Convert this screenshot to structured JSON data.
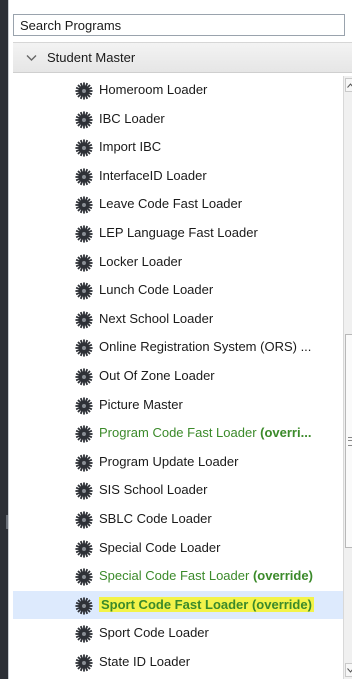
{
  "search": {
    "placeholder": "Search Programs",
    "value": ""
  },
  "group": {
    "title": "Student Master",
    "expanded": true
  },
  "items": [
    {
      "label": "Homeroom Loader",
      "suffix": ""
    },
    {
      "label": "IBC Loader",
      "suffix": ""
    },
    {
      "label": "Import IBC",
      "suffix": ""
    },
    {
      "label": "InterfaceID Loader",
      "suffix": ""
    },
    {
      "label": "Leave Code Fast Loader",
      "suffix": ""
    },
    {
      "label": "LEP Language Fast Loader",
      "suffix": ""
    },
    {
      "label": "Locker Loader",
      "suffix": ""
    },
    {
      "label": "Lunch Code Loader",
      "suffix": ""
    },
    {
      "label": "Next School Loader",
      "suffix": ""
    },
    {
      "label": "Online Registration System (ORS) ...",
      "suffix": ""
    },
    {
      "label": "Out Of Zone Loader",
      "suffix": ""
    },
    {
      "label": "Picture Master",
      "suffix": ""
    },
    {
      "label": "Program Code Fast Loader ",
      "suffix": "(overri...",
      "green": true
    },
    {
      "label": "Program Update Loader",
      "suffix": ""
    },
    {
      "label": "SIS School Loader",
      "suffix": ""
    },
    {
      "label": "SBLC Code Loader",
      "suffix": ""
    },
    {
      "label": "Special Code Loader",
      "suffix": ""
    },
    {
      "label": "Special Code Fast Loader ",
      "suffix": "(override)",
      "green": true
    },
    {
      "label": "Sport Code Fast Loader (override)",
      "suffix": "",
      "selected": true
    },
    {
      "label": "Sport Code Loader",
      "suffix": ""
    },
    {
      "label": "State ID Loader",
      "suffix": ""
    }
  ],
  "colors": {
    "green_text": "#3b8a2a",
    "highlight": "#f3f34a",
    "selected_row": "#ddeafd"
  },
  "icons": {
    "group_toggle": "chevron-down-icon",
    "item": "gear-icon",
    "scroll_up": "arrow-up-icon",
    "scroll_down": "arrow-down-icon"
  }
}
